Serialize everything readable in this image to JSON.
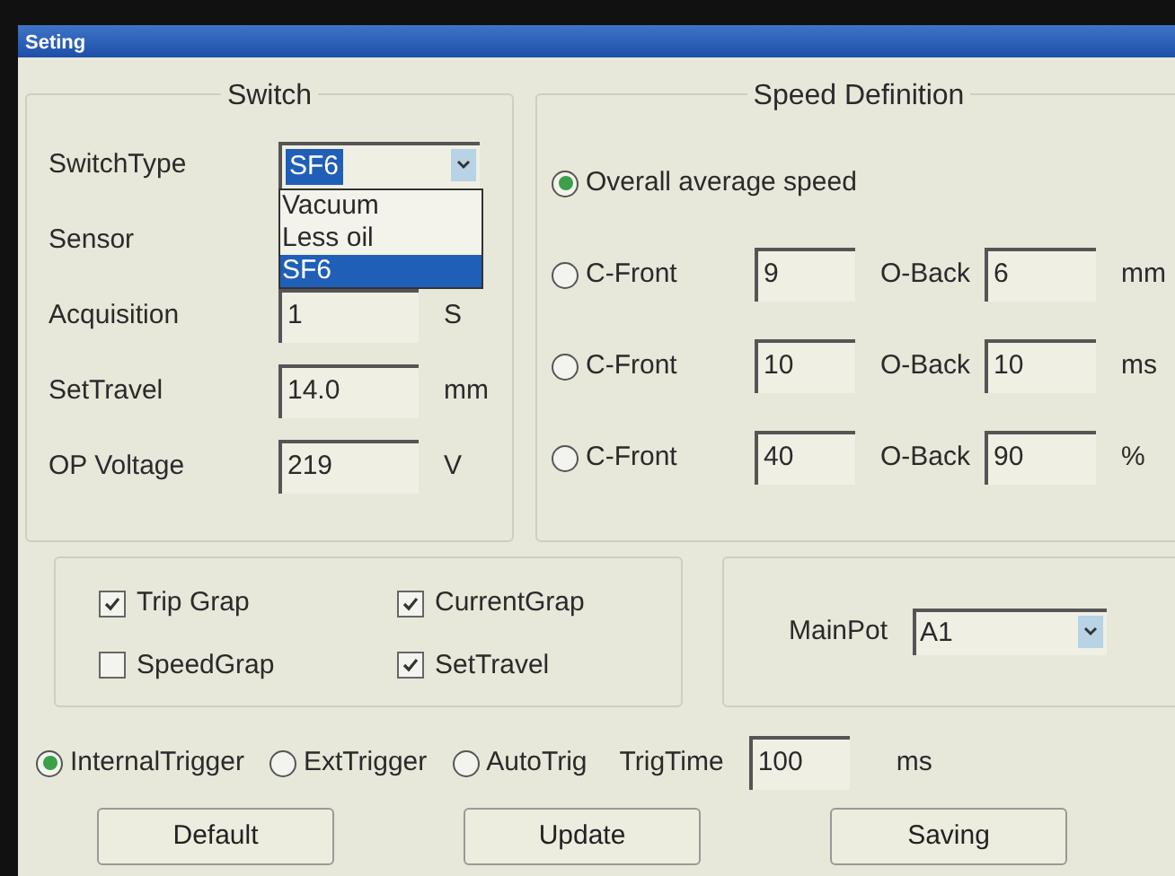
{
  "window": {
    "title": "Seting"
  },
  "switch_group": {
    "title": "Switch",
    "switch_type": {
      "label": "SwitchType",
      "value": "SF6",
      "expanded": true,
      "options": [
        {
          "label": "Vacuum",
          "selected": false
        },
        {
          "label": "Less oil",
          "selected": false
        },
        {
          "label": "SF6",
          "selected": true
        }
      ]
    },
    "fields": [
      {
        "label": "Sensor"
      },
      {
        "label": "Acquisition",
        "value": "1",
        "unit": "S"
      },
      {
        "label": "SetTravel",
        "value": "14.0",
        "unit": "mm"
      },
      {
        "label": "OP Voltage",
        "value": "219",
        "unit": "V"
      }
    ]
  },
  "speed_definition": {
    "title": "Speed Definition",
    "modes": [
      {
        "kind": "overall",
        "label": "Overall average speed",
        "selected": true
      },
      {
        "kind": "pair",
        "label": "C-Front",
        "value": "9",
        "label_2": "O-Back",
        "value_2": "6",
        "unit": "mm",
        "selected": false
      },
      {
        "kind": "pair",
        "label": "C-Front",
        "value": "10",
        "label_2": "O-Back",
        "value_2": "10",
        "unit": "ms",
        "selected": false
      },
      {
        "kind": "pair",
        "label": "C-Front",
        "value": "40",
        "label_2": "O-Back",
        "value_2": "90",
        "unit": "%",
        "selected": false
      }
    ]
  },
  "graphs": [
    {
      "label": "Trip Grap",
      "checked": true
    },
    {
      "label": "CurrentGrap",
      "checked": true
    },
    {
      "label": "SpeedGrap",
      "checked": false
    },
    {
      "label": "SetTravel",
      "checked": true
    }
  ],
  "main_pot": {
    "label": "MainPot",
    "value": "A1"
  },
  "triggers": [
    {
      "label": "InternalTrigger",
      "selected": true
    },
    {
      "label": "ExtTrigger",
      "selected": false
    },
    {
      "label": "AutoTrig",
      "selected": false
    }
  ],
  "trig_time": {
    "label": "TrigTime",
    "value": "100",
    "unit": "ms"
  },
  "buttons": [
    "Default",
    "Update",
    "Saving"
  ]
}
